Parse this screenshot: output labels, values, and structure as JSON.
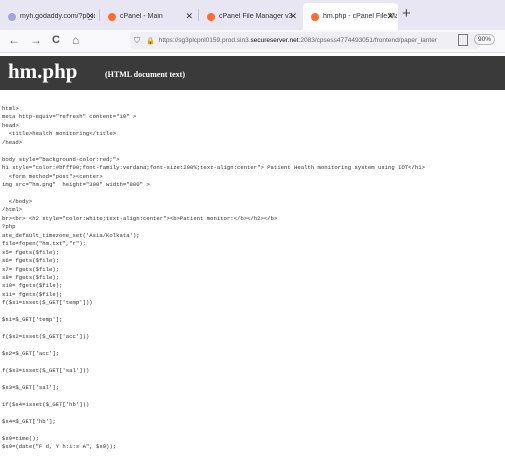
{
  "tabs": [
    {
      "label": "myh.godaddy.com/?pl_id=1&",
      "close": "✕",
      "icon": "globe-icon",
      "color": "#a7a3d6"
    },
    {
      "label": "cPanel - Main",
      "close": "✕",
      "icon": "cpanel-icon",
      "color": "#ff6c2c"
    },
    {
      "label": "cPanel File Manager v3",
      "close": "✕",
      "icon": "cpanel-icon",
      "color": "#ff6c2c"
    },
    {
      "label": "hm.php - cPanel File Manager",
      "close": "✕",
      "icon": "cpanel-icon",
      "color": "#ff6c2c"
    }
  ],
  "new_tab": "+",
  "nav": {
    "back": "←",
    "forward": "→",
    "reload": "C",
    "home": "⌂"
  },
  "url": {
    "shield": "⛉",
    "lock": "🔒",
    "prefix": "https://sg3plcpnl0159.prod.sin3.",
    "domain": "secureserver.net",
    "suffix": ":2083/cpsess4774493051/frontend/paper_lanter"
  },
  "zoom": "90%",
  "doc": {
    "title": "hm.php",
    "subtitle": "(HTML document text)"
  },
  "code_lines": [
    "html>",
    "meta http-equiv=\"refresh\" content=\"10\" >",
    "head>",
    "  <title>health monitoring</title>",
    "/head>",
    "",
    "body style=\"background-color:red;\">",
    "h1 style=\"color:#bfff00;font-family:verdana;font-size:200%;text-align:center\"> Patient Health monitoring system using IOT</h1>",
    "  <form method=\"post\"><center>",
    "img src=\"hm.png\"  height=\"300\" width=\"800\" >",
    "",
    "  </body>",
    "/html>",
    "br><br> <h2 style=\"color:white;text-align:center\"><b>Patient monitor:</b></h2></b>",
    "?php",
    "ate_default_timezone_set('Asia/Kolkata');",
    "file=fopen(\"hm.txt\",\"r\");",
    "s5= fgets($file);",
    "s6= fgets($file);",
    "s7= fgets($file);",
    "s8= fgets($file);",
    "s10= fgets($file);",
    "s11= fgets($file);",
    "f($s1=isset($_GET['temp']))",
    "",
    "$s1=$_GET['temp'];",
    "",
    "f($s2=isset($_GET['acc']))",
    "",
    "$s2=$_GET['acc'];",
    "",
    "f($s3=isset($_GET['sal']))",
    "",
    "$s3=$_GET['sal'];",
    "",
    "if($s4=isset($_GET['hb']))",
    "",
    "$s4=$_GET['hb'];",
    "",
    "$s9=time();",
    "$s9=(date(\"F d, Y h:i:s A\", $s9));"
  ]
}
